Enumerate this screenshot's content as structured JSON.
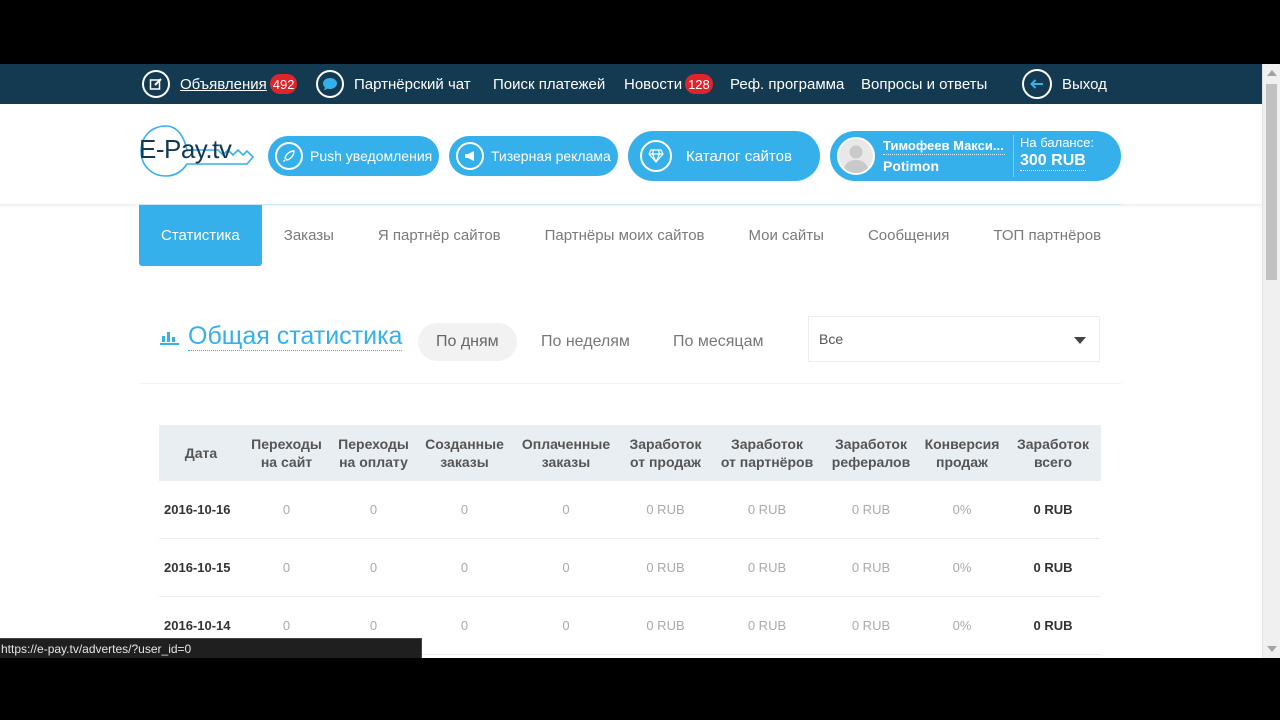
{
  "topnav": {
    "items": [
      {
        "label": "Объявления",
        "badge": "492",
        "icon": "edit-icon"
      },
      {
        "label": "Партнёрский чат",
        "icon": "chat-bubble-icon"
      },
      {
        "label": "Поиск платежей"
      },
      {
        "label": "Новости",
        "badge": "128"
      },
      {
        "label": "Реф. программа"
      },
      {
        "label": "Вопросы и ответы"
      },
      {
        "label": "Выход",
        "icon": "logout-arrow-icon"
      }
    ]
  },
  "header": {
    "logo_text": "E-Pay.tv",
    "buttons": [
      {
        "label": "Push уведомления",
        "icon": "rocket-icon"
      },
      {
        "label": "Тизерная реклама",
        "icon": "megaphone-icon"
      },
      {
        "label": "Каталог сайтов",
        "icon": "diamond-icon"
      }
    ],
    "user": {
      "name": "Тимофеев Макси...",
      "login": "Potimon",
      "balance_label": "На балансе:",
      "balance_value": "300 RUB"
    }
  },
  "tabs": [
    "Статистика",
    "Заказы",
    "Я партнёр сайтов",
    "Партнёры моих сайтов",
    "Мои сайты",
    "Сообщения",
    "ТОП партнёров"
  ],
  "stats": {
    "title": "Общая статистика",
    "periods": [
      "По дням",
      "По неделям",
      "По месяцам"
    ],
    "filter_value": "Все"
  },
  "table": {
    "headers": [
      [
        "Дата"
      ],
      [
        "Переходы",
        "на сайт"
      ],
      [
        "Переходы",
        "на оплату"
      ],
      [
        "Созданные",
        "заказы"
      ],
      [
        "Оплаченные",
        "заказы"
      ],
      [
        "Заработок",
        "от продаж"
      ],
      [
        "Заработок",
        "от партнёров"
      ],
      [
        "Заработок",
        "рефералов"
      ],
      [
        "Конверсия",
        "продаж"
      ],
      [
        "Заработок",
        "всего"
      ]
    ],
    "rows": [
      [
        "2016-10-16",
        "0",
        "0",
        "0",
        "0",
        "0 RUB",
        "0 RUB",
        "0 RUB",
        "0%",
        "0 RUB"
      ],
      [
        "2016-10-15",
        "0",
        "0",
        "0",
        "0",
        "0 RUB",
        "0 RUB",
        "0 RUB",
        "0%",
        "0 RUB"
      ],
      [
        "2016-10-14",
        "0",
        "0",
        "0",
        "0",
        "0 RUB",
        "0 RUB",
        "0 RUB",
        "0%",
        "0 RUB"
      ]
    ]
  },
  "statusbar": {
    "url": "https://e-pay.tv/advertes/?user_id=0"
  },
  "colors": {
    "accent": "#35b0ea",
    "nav_bg": "#143a52",
    "badge": "#e0242b"
  }
}
